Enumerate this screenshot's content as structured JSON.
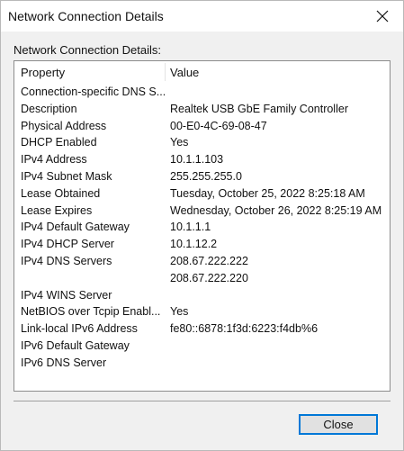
{
  "window": {
    "title": "Network Connection Details"
  },
  "section_label": "Network Connection Details:",
  "table": {
    "columns": [
      "Property",
      "Value"
    ],
    "rows": [
      {
        "property": "Connection-specific DNS S...",
        "value": ""
      },
      {
        "property": "Description",
        "value": "Realtek USB GbE Family Controller"
      },
      {
        "property": "Physical Address",
        "value": "00-E0-4C-69-08-47"
      },
      {
        "property": "DHCP Enabled",
        "value": "Yes"
      },
      {
        "property": "IPv4 Address",
        "value": "10.1.1.103"
      },
      {
        "property": "IPv4 Subnet Mask",
        "value": "255.255.255.0"
      },
      {
        "property": "Lease Obtained",
        "value": "Tuesday, October 25, 2022 8:25:18 AM"
      },
      {
        "property": "Lease Expires",
        "value": "Wednesday, October 26, 2022 8:25:19 AM"
      },
      {
        "property": "IPv4 Default Gateway",
        "value": "10.1.1.1"
      },
      {
        "property": "IPv4 DHCP Server",
        "value": "10.1.12.2"
      },
      {
        "property": "IPv4 DNS Servers",
        "value": "208.67.222.222"
      },
      {
        "property": "",
        "value": "208.67.222.220"
      },
      {
        "property": "IPv4 WINS Server",
        "value": ""
      },
      {
        "property": "NetBIOS over Tcpip Enabl...",
        "value": "Yes"
      },
      {
        "property": "Link-local IPv6 Address",
        "value": "fe80::6878:1f3d:6223:f4db%6"
      },
      {
        "property": "IPv6 Default Gateway",
        "value": ""
      },
      {
        "property": "IPv6 DNS Server",
        "value": ""
      }
    ]
  },
  "buttons": {
    "close_label": "Close"
  },
  "icons": {
    "window_close": "close-icon"
  },
  "colors": {
    "button_focus_border": "#0078d7",
    "dialog_background": "#f0f0f0"
  }
}
